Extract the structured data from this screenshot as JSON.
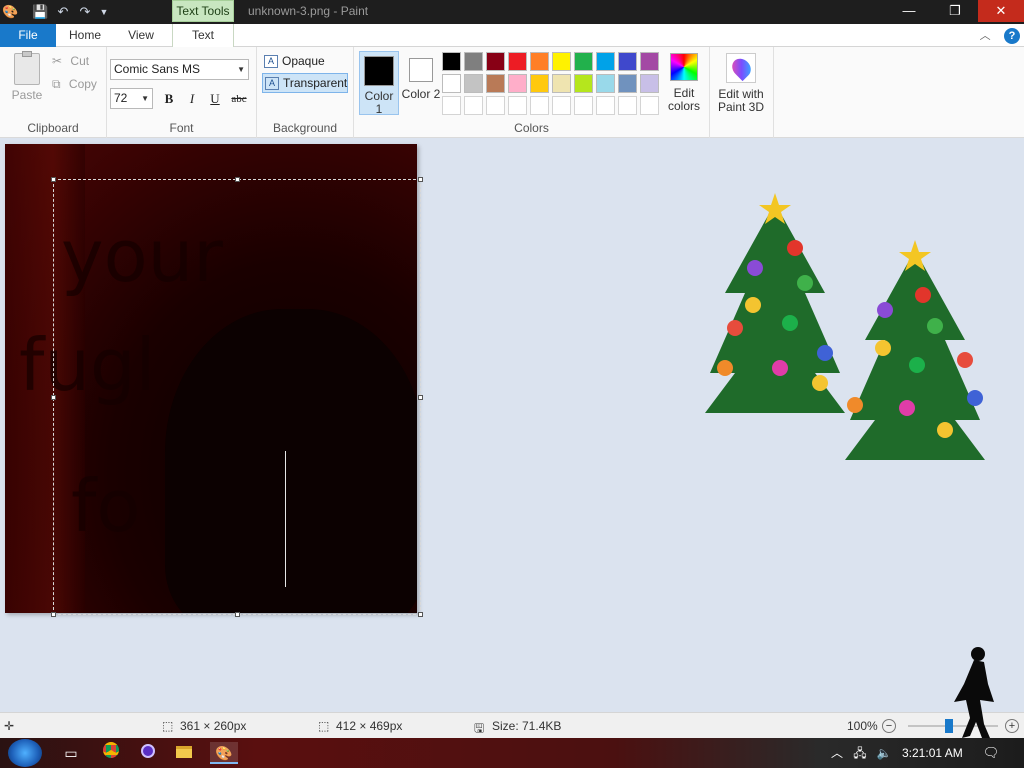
{
  "titlebar": {
    "context_tab": "Text Tools",
    "title": "unknown-3.png - Paint",
    "minimize": "—",
    "restore": "❐",
    "close": "✕"
  },
  "tabs": [
    {
      "label": "File"
    },
    {
      "label": "Home"
    },
    {
      "label": "View"
    },
    {
      "label": "Text"
    }
  ],
  "ribbon": {
    "clipboard": {
      "label": "Clipboard",
      "paste": "Paste",
      "cut": "Cut",
      "copy": "Copy"
    },
    "font": {
      "label": "Font",
      "family": "Comic Sans MS",
      "size": "72",
      "bold": "B",
      "italic": "I",
      "underline": "U",
      "strike": "abc"
    },
    "background": {
      "label": "Background",
      "opaque": "Opaque",
      "transparent": "Transparent",
      "selected": "transparent"
    },
    "colors": {
      "label": "Colors",
      "color1_label": "Color 1",
      "color1_value": "#000000",
      "color2_label": "Color 2",
      "color2_value": "#ffffff",
      "edit_colors": "Edit colors",
      "palette_row1": [
        "#000000",
        "#7f7f7f",
        "#880015",
        "#ed1c24",
        "#ff7f27",
        "#fff200",
        "#22b14c",
        "#00a2e8",
        "#3f48cc",
        "#a349a4"
      ],
      "palette_row2": [
        "#ffffff",
        "#c3c3c3",
        "#b97a57",
        "#ffaec9",
        "#ffc90e",
        "#efe4b0",
        "#b5e61d",
        "#99d9ea",
        "#7092be",
        "#c8bfe7"
      ],
      "palette_row3": [
        "#ffffff",
        "#ffffff",
        "#ffffff",
        "#ffffff",
        "#ffffff",
        "#ffffff",
        "#ffffff",
        "#ffffff",
        "#ffffff",
        "#ffffff"
      ]
    },
    "paint3d": "Edit with Paint 3D"
  },
  "canvas": {
    "text_line1": "your",
    "text_line2": "fugl",
    "text_line3": "fo"
  },
  "statusbar": {
    "selection_size": "361 × 260px",
    "image_size": "412 × 469px",
    "file_size": "Size: 71.4KB",
    "zoom": "100%"
  },
  "taskbar": {
    "clock": "3:21:01 AM"
  }
}
